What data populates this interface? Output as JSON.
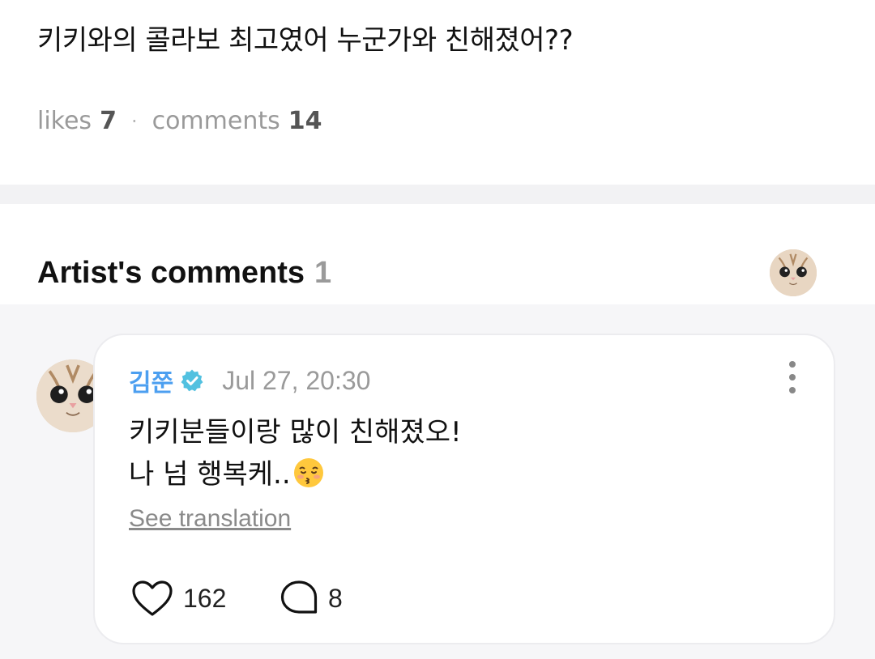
{
  "post": {
    "text": "키키와의 콜라보 최고였어 누군가와 친해졌어??",
    "likes_label": "likes",
    "likes_count": "7",
    "separator": "·",
    "comments_label": "comments",
    "comments_count": "14"
  },
  "artist_comments": {
    "title": "Artist's comments",
    "count": "1",
    "comment": {
      "author": "김쭌",
      "verified": true,
      "timestamp": "Jul 27, 20:30",
      "lines": [
        "키키분들이랑 많이 친해졌오!",
        "나 넘 행복케.."
      ],
      "emoji": "kissing-face-with-closed-eyes",
      "see_translation": "See translation",
      "likes": "162",
      "replies": "8"
    }
  },
  "colors": {
    "author_name": "#4c9ff0",
    "verified_badge": "#52c1e0",
    "muted_text": "#9a9a9a",
    "band_background": "#f2f2f4",
    "comments_background": "#f6f6f8"
  }
}
